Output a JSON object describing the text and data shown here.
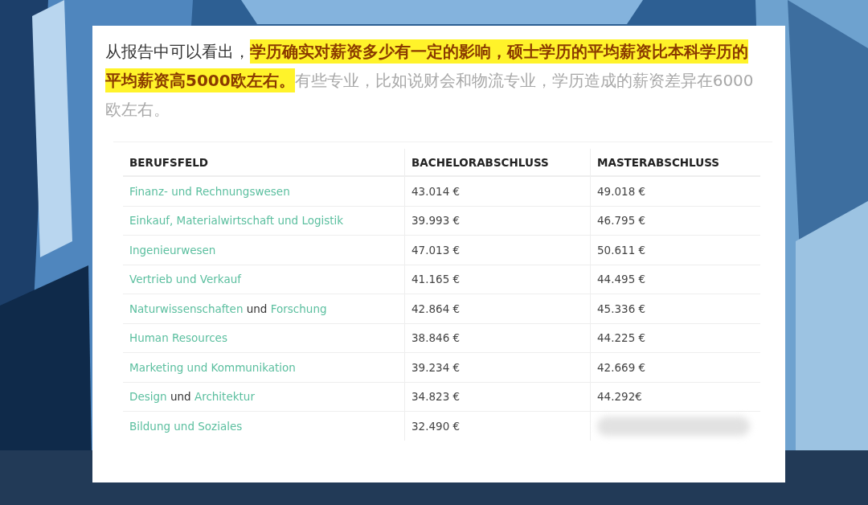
{
  "intro": [
    {
      "text": "从报告中可以看出，",
      "kind": "normal"
    },
    {
      "text": "学历确实对薪资多少有一定的影响，硕士学历的平均薪资比本科学历的平均薪资高5000欧左右。",
      "kind": "highlight"
    },
    {
      "text": "有些专业，比如说财会和物流专业，学历造成的薪资差异在6000欧左右。",
      "kind": "muted"
    }
  ],
  "table": {
    "columns": [
      "BERUFSFELD",
      "BACHELORABSCHLUSS",
      "MASTERABSCHLUSS"
    ],
    "rows": [
      {
        "field": [
          {
            "text": "Finanz- und Rechnungswesen",
            "link": true
          }
        ],
        "bachelor": "43.014 €",
        "master": "49.018 €",
        "master_blurred": false
      },
      {
        "field": [
          {
            "text": "Einkauf, Materialwirtschaft und Logistik",
            "link": true
          }
        ],
        "bachelor": "39.993 €",
        "master": "46.795 €",
        "master_blurred": false
      },
      {
        "field": [
          {
            "text": "Ingenieurwesen",
            "link": true
          }
        ],
        "bachelor": "47.013 €",
        "master": "50.611 €",
        "master_blurred": false
      },
      {
        "field": [
          {
            "text": "Vertrieb und Verkauf",
            "link": true
          }
        ],
        "bachelor": "41.165 €",
        "master": "44.495 €",
        "master_blurred": false
      },
      {
        "field": [
          {
            "text": "Naturwissenschaften",
            "link": true
          },
          {
            "text": "und",
            "link": false
          },
          {
            "text": "Forschung",
            "link": true
          }
        ],
        "bachelor": "42.864 €",
        "master": "45.336 €",
        "master_blurred": false
      },
      {
        "field": [
          {
            "text": "Human Resources",
            "link": true
          }
        ],
        "bachelor": "38.846 €",
        "master": "44.225 €",
        "master_blurred": false
      },
      {
        "field": [
          {
            "text": "Marketing und Kommunikation",
            "link": true
          }
        ],
        "bachelor": "39.234 €",
        "master": "42.669 €",
        "master_blurred": false
      },
      {
        "field": [
          {
            "text": "Design",
            "link": true
          },
          {
            "text": "und",
            "link": false
          },
          {
            "text": "Architektur",
            "link": true
          }
        ],
        "bachelor": "34.823 €",
        "master": "44.292€",
        "master_blurred": false
      },
      {
        "field": [
          {
            "text": "Bildung und Soziales",
            "link": true
          }
        ],
        "bachelor": "32.490 €",
        "master_blurred": true
      }
    ]
  }
}
